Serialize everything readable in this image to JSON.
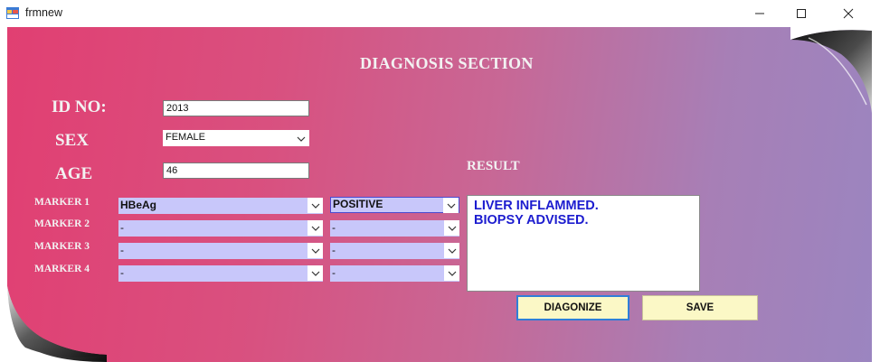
{
  "window": {
    "title": "frmnew"
  },
  "form": {
    "heading": "DIAGNOSIS SECTION",
    "id_label": "ID NO:",
    "id_value": "2013",
    "sex_label": "SEX",
    "sex_value": "FEMALE",
    "age_label": "AGE",
    "age_value": "46",
    "result_label": "RESULT"
  },
  "markers": [
    {
      "label": "MARKER 1",
      "name": "HBeAg",
      "result": "POSITIVE"
    },
    {
      "label": "MARKER 2",
      "name": "-",
      "result": "-"
    },
    {
      "label": "MARKER 3",
      "name": "-",
      "result": "-"
    },
    {
      "label": "MARKER 4",
      "name": "-",
      "result": "-"
    }
  ],
  "result_text": [
    "LIVER INFLAMMED.",
    "BIOPSY ADVISED."
  ],
  "buttons": {
    "diagnose": "DIAGONIZE",
    "save": "SAVE"
  },
  "colors": {
    "gradient_left": "#e13f72",
    "gradient_right": "#9b85c0",
    "combo_fill": "#c8c7fa",
    "result_text": "#1c1ccf",
    "button_fill": "#fbf8c6"
  }
}
